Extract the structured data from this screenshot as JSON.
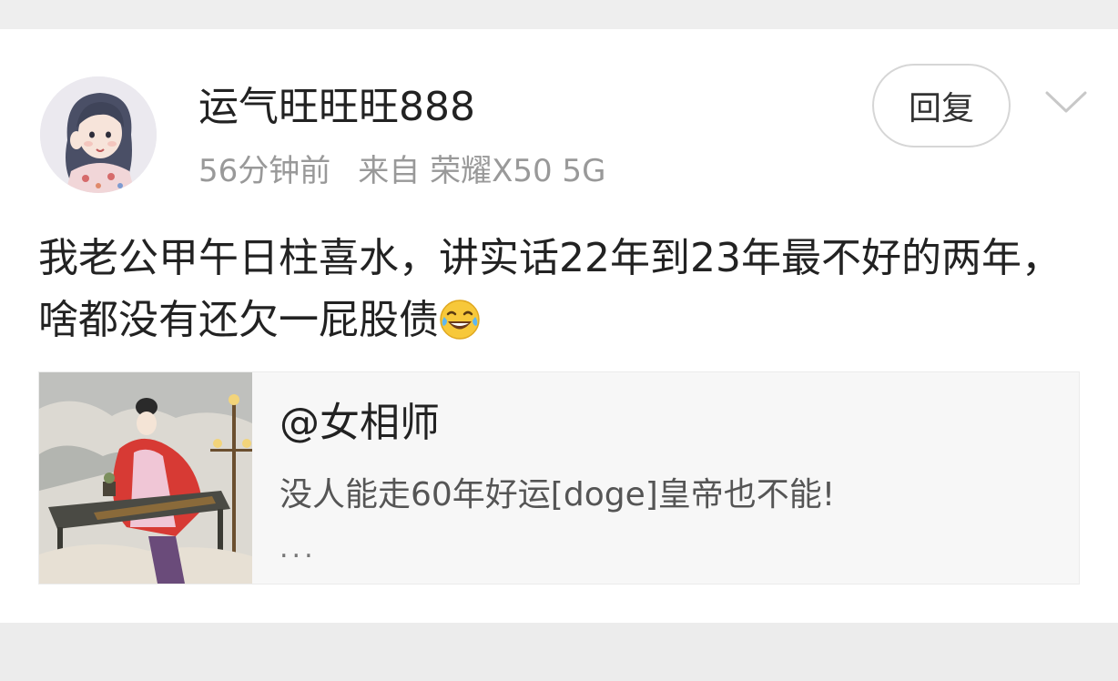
{
  "post": {
    "username": "运气旺旺旺888",
    "time": "56分钟前",
    "source": "来自 荣耀X50 5G",
    "reply_label": "回复",
    "text": "我老公甲午日柱喜水，讲实话22年到23年最不好的两年，啥都没有还欠一屁股债"
  },
  "quote": {
    "name": "@女相师",
    "body": "没人能走60年好运[doge]皇帝也不能!",
    "ellipsis": "..."
  },
  "icons": {
    "reply_menu": "chevron-down-icon",
    "emoji": "laughing-tears-emoji"
  },
  "colors": {
    "username": "#222222",
    "meta": "#999999",
    "quote_bg": "#f7f7f7"
  }
}
